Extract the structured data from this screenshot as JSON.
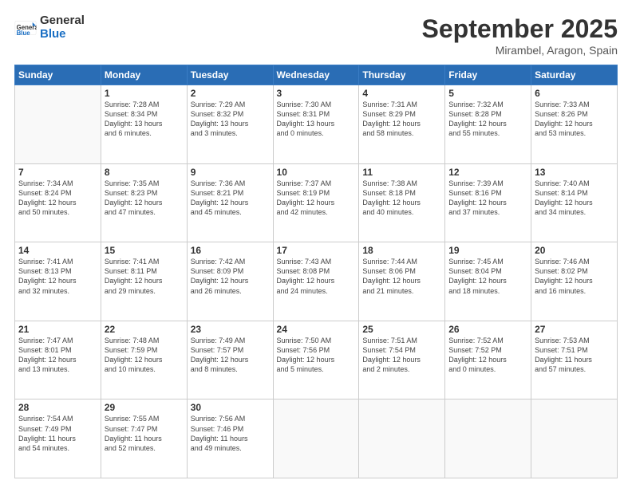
{
  "logo": {
    "general": "General",
    "blue": "Blue"
  },
  "title": {
    "month": "September 2025",
    "location": "Mirambel, Aragon, Spain"
  },
  "weekdays": [
    "Sunday",
    "Monday",
    "Tuesday",
    "Wednesday",
    "Thursday",
    "Friday",
    "Saturday"
  ],
  "weeks": [
    [
      {
        "day": "",
        "info": ""
      },
      {
        "day": "1",
        "info": "Sunrise: 7:28 AM\nSunset: 8:34 PM\nDaylight: 13 hours\nand 6 minutes."
      },
      {
        "day": "2",
        "info": "Sunrise: 7:29 AM\nSunset: 8:32 PM\nDaylight: 13 hours\nand 3 minutes."
      },
      {
        "day": "3",
        "info": "Sunrise: 7:30 AM\nSunset: 8:31 PM\nDaylight: 13 hours\nand 0 minutes."
      },
      {
        "day": "4",
        "info": "Sunrise: 7:31 AM\nSunset: 8:29 PM\nDaylight: 12 hours\nand 58 minutes."
      },
      {
        "day": "5",
        "info": "Sunrise: 7:32 AM\nSunset: 8:28 PM\nDaylight: 12 hours\nand 55 minutes."
      },
      {
        "day": "6",
        "info": "Sunrise: 7:33 AM\nSunset: 8:26 PM\nDaylight: 12 hours\nand 53 minutes."
      }
    ],
    [
      {
        "day": "7",
        "info": "Sunrise: 7:34 AM\nSunset: 8:24 PM\nDaylight: 12 hours\nand 50 minutes."
      },
      {
        "day": "8",
        "info": "Sunrise: 7:35 AM\nSunset: 8:23 PM\nDaylight: 12 hours\nand 47 minutes."
      },
      {
        "day": "9",
        "info": "Sunrise: 7:36 AM\nSunset: 8:21 PM\nDaylight: 12 hours\nand 45 minutes."
      },
      {
        "day": "10",
        "info": "Sunrise: 7:37 AM\nSunset: 8:19 PM\nDaylight: 12 hours\nand 42 minutes."
      },
      {
        "day": "11",
        "info": "Sunrise: 7:38 AM\nSunset: 8:18 PM\nDaylight: 12 hours\nand 40 minutes."
      },
      {
        "day": "12",
        "info": "Sunrise: 7:39 AM\nSunset: 8:16 PM\nDaylight: 12 hours\nand 37 minutes."
      },
      {
        "day": "13",
        "info": "Sunrise: 7:40 AM\nSunset: 8:14 PM\nDaylight: 12 hours\nand 34 minutes."
      }
    ],
    [
      {
        "day": "14",
        "info": "Sunrise: 7:41 AM\nSunset: 8:13 PM\nDaylight: 12 hours\nand 32 minutes."
      },
      {
        "day": "15",
        "info": "Sunrise: 7:41 AM\nSunset: 8:11 PM\nDaylight: 12 hours\nand 29 minutes."
      },
      {
        "day": "16",
        "info": "Sunrise: 7:42 AM\nSunset: 8:09 PM\nDaylight: 12 hours\nand 26 minutes."
      },
      {
        "day": "17",
        "info": "Sunrise: 7:43 AM\nSunset: 8:08 PM\nDaylight: 12 hours\nand 24 minutes."
      },
      {
        "day": "18",
        "info": "Sunrise: 7:44 AM\nSunset: 8:06 PM\nDaylight: 12 hours\nand 21 minutes."
      },
      {
        "day": "19",
        "info": "Sunrise: 7:45 AM\nSunset: 8:04 PM\nDaylight: 12 hours\nand 18 minutes."
      },
      {
        "day": "20",
        "info": "Sunrise: 7:46 AM\nSunset: 8:02 PM\nDaylight: 12 hours\nand 16 minutes."
      }
    ],
    [
      {
        "day": "21",
        "info": "Sunrise: 7:47 AM\nSunset: 8:01 PM\nDaylight: 12 hours\nand 13 minutes."
      },
      {
        "day": "22",
        "info": "Sunrise: 7:48 AM\nSunset: 7:59 PM\nDaylight: 12 hours\nand 10 minutes."
      },
      {
        "day": "23",
        "info": "Sunrise: 7:49 AM\nSunset: 7:57 PM\nDaylight: 12 hours\nand 8 minutes."
      },
      {
        "day": "24",
        "info": "Sunrise: 7:50 AM\nSunset: 7:56 PM\nDaylight: 12 hours\nand 5 minutes."
      },
      {
        "day": "25",
        "info": "Sunrise: 7:51 AM\nSunset: 7:54 PM\nDaylight: 12 hours\nand 2 minutes."
      },
      {
        "day": "26",
        "info": "Sunrise: 7:52 AM\nSunset: 7:52 PM\nDaylight: 12 hours\nand 0 minutes."
      },
      {
        "day": "27",
        "info": "Sunrise: 7:53 AM\nSunset: 7:51 PM\nDaylight: 11 hours\nand 57 minutes."
      }
    ],
    [
      {
        "day": "28",
        "info": "Sunrise: 7:54 AM\nSunset: 7:49 PM\nDaylight: 11 hours\nand 54 minutes."
      },
      {
        "day": "29",
        "info": "Sunrise: 7:55 AM\nSunset: 7:47 PM\nDaylight: 11 hours\nand 52 minutes."
      },
      {
        "day": "30",
        "info": "Sunrise: 7:56 AM\nSunset: 7:46 PM\nDaylight: 11 hours\nand 49 minutes."
      },
      {
        "day": "",
        "info": ""
      },
      {
        "day": "",
        "info": ""
      },
      {
        "day": "",
        "info": ""
      },
      {
        "day": "",
        "info": ""
      }
    ]
  ]
}
